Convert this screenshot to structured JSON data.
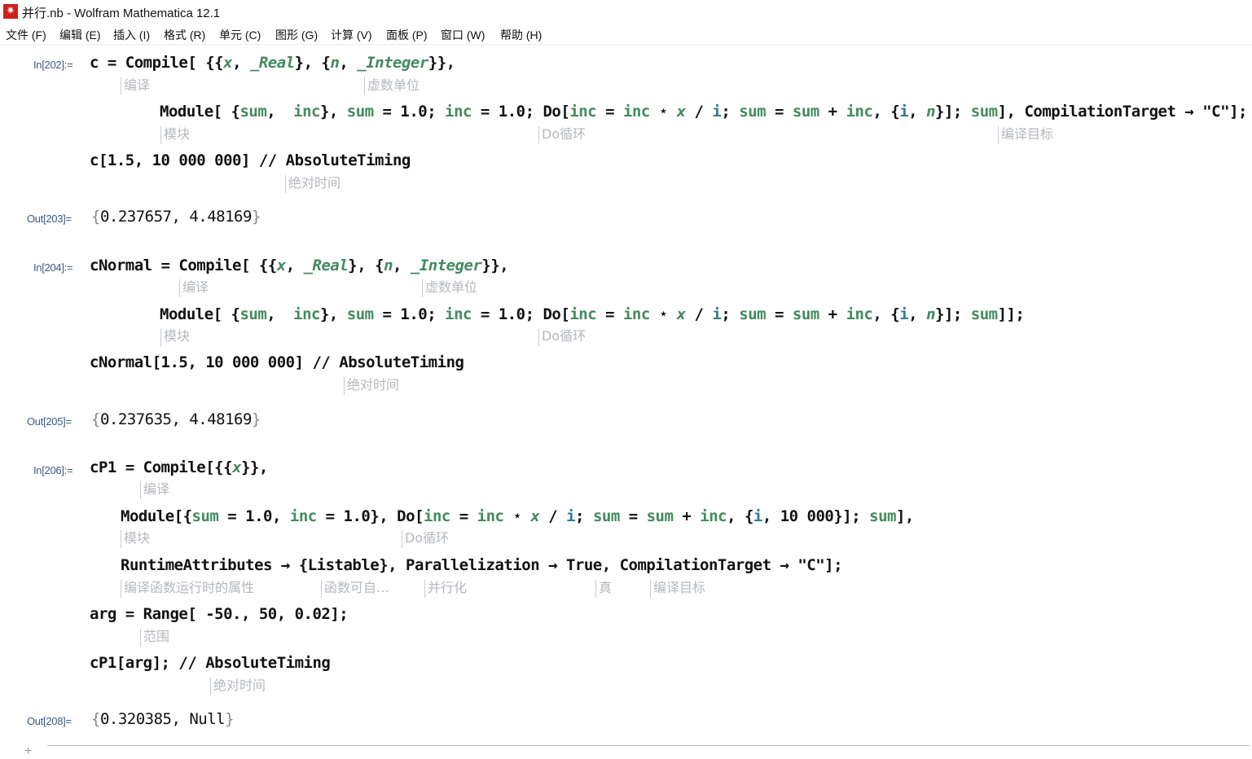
{
  "window": {
    "title": "并行.nb - Wolfram Mathematica 12.1",
    "icon": "mathematica-spikey-icon"
  },
  "menu": [
    "文件 (F)",
    "编辑 (E)",
    "插入 (I)",
    "格式 (R)",
    "单元 (C)",
    "图形 (G)",
    "计算 (V)",
    "面板 (P)",
    "窗口 (W)",
    "帮助 (H)"
  ],
  "cells": {
    "in202": {
      "label": "In[202]:=",
      "line1": {
        "var": "c",
        "eq": " = ",
        "fn": "Compile",
        "open": "[ {{",
        "x": "x",
        "c1": ", ",
        "real": "_Real",
        "c2": "}, {",
        "n": "n",
        "c3": ", ",
        "int": "_Integer",
        "close": "}},"
      },
      "line1_hints": [
        "编译",
        "虚数单位"
      ],
      "line2": {
        "fn": "Module",
        "p1": "[ {",
        "sum": "sum",
        "c1": ",  ",
        "inc": "inc",
        "p2": "}, ",
        "sum2": "sum",
        "eq1": " = 1.0; ",
        "inc2": "inc",
        "eq2": " = 1.0; ",
        "do": "Do",
        "p3": "[",
        "inc3": "inc",
        "eq3": " = ",
        "inc4": "inc",
        "mul": " ⋆ ",
        "x": "x",
        "div": " / ",
        "i": "i",
        "semi": "; ",
        "sum3": "sum",
        "eq4": " = ",
        "sum4": "sum",
        "plus": " + ",
        "inc5": "inc",
        "p4": ", {",
        "i2": "i",
        "c2": ", ",
        "n": "n",
        "p5": "}]; ",
        "sum5": "sum",
        "p6": "], ",
        "target": "CompilationTarget",
        "arrow": " → ",
        "str": "\"C\"",
        "end": "];"
      },
      "line2_hints": [
        "模块",
        "Do循环",
        "编译目标"
      ],
      "line3": {
        "text": "c[1.5, 10 000 000] // ",
        "fn": "AbsoluteTiming"
      },
      "line3_hints": [
        "绝对时间"
      ]
    },
    "out203": {
      "label": "Out[203]=",
      "open": "{",
      "value": "0.237657, 4.48169",
      "close": "}"
    },
    "in204": {
      "label": "In[204]:=",
      "line1": {
        "var": "cNormal",
        "eq": " = ",
        "fn": "Compile",
        "open": "[ {{",
        "x": "x",
        "c1": ", ",
        "real": "_Real",
        "c2": "}, {",
        "n": "n",
        "c3": ", ",
        "int": "_Integer",
        "close": "}},"
      },
      "line1_hints": [
        "编译",
        "虚数单位"
      ],
      "line2": {
        "fn": "Module",
        "p1": "[ {",
        "sum": "sum",
        "c1": ",  ",
        "inc": "inc",
        "p2": "}, ",
        "sum2": "sum",
        "eq1": " = 1.0; ",
        "inc2": "inc",
        "eq2": " = 1.0; ",
        "do": "Do",
        "p3": "[",
        "inc3": "inc",
        "eq3": " = ",
        "inc4": "inc",
        "mul": " ⋆ ",
        "x": "x",
        "div": " / ",
        "i": "i",
        "semi": "; ",
        "sum3": "sum",
        "eq4": " = ",
        "sum4": "sum",
        "plus": " + ",
        "inc5": "inc",
        "p4": ", {",
        "i2": "i",
        "c2": ", ",
        "n": "n",
        "p5": "}]; ",
        "sum5": "sum",
        "end": "]];"
      },
      "line2_hints": [
        "模块",
        "Do循环"
      ],
      "line3": {
        "text": "cNormal[1.5, 10 000 000] // ",
        "fn": "AbsoluteTiming"
      },
      "line3_hints": [
        "绝对时间"
      ]
    },
    "out205": {
      "label": "Out[205]=",
      "open": "{",
      "value": "0.237635, 4.48169",
      "close": "}"
    },
    "in206": {
      "label": "In[206]:=",
      "line1": {
        "var": "cP1",
        "eq": " = ",
        "fn": "Compile",
        "open": "[{{",
        "x": "x",
        "close": "}},"
      },
      "line1_hints": [
        "编译"
      ],
      "line2": {
        "fn": "Module",
        "p1": "[{",
        "sum": "sum",
        "eq1": " = 1.0, ",
        "inc": "inc",
        "eq2": " = 1.0}, ",
        "do": "Do",
        "p3": "[",
        "inc3": "inc",
        "eq3": " = ",
        "inc4": "inc",
        "mul": " ⋆ ",
        "x": "x",
        "div": " / ",
        "i": "i",
        "semi": "; ",
        "sum3": "sum",
        "eq4": " = ",
        "sum4": "sum",
        "plus": " + ",
        "inc5": "inc",
        "p4": ", {",
        "i2": "i",
        "c2": ", 10 000}]; ",
        "sum5": "sum",
        "end": "],"
      },
      "line2_hints": [
        "模块",
        "Do循环"
      ],
      "line3": {
        "text": "RuntimeAttributes → {Listable}, Parallelization → True, CompilationTarget → \"C\"];"
      },
      "line3_hints": [
        "编译函数运行时的属性",
        "函数可自…",
        "并行化",
        "真",
        "编译目标"
      ],
      "line4": {
        "text": "arg = Range[ -50., 50, 0.02];"
      },
      "line4_hints": [
        "范围"
      ],
      "line5": {
        "text": "cP1[arg]; // AbsoluteTiming"
      },
      "line5_hints": [
        "绝对时间"
      ]
    },
    "out208": {
      "label": "Out[208]=",
      "open": "{",
      "value": "0.320385, Null",
      "close": "}"
    }
  },
  "footer": {
    "add_cell": "+"
  }
}
